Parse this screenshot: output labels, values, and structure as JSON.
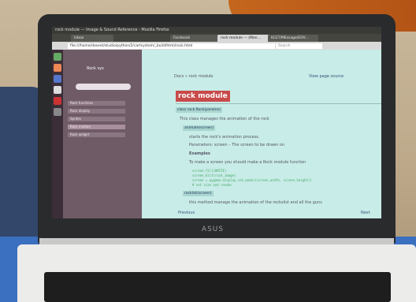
{
  "scene": {
    "table_color": "#3b6fc0",
    "wall_color": "#c9b89c"
  },
  "laptop": {
    "brand": "ASUS"
  },
  "browser": {
    "window_title": "rock module — Image & Sound Reference - Mozilla Firefox",
    "tabs": [
      {
        "label": "Inbox"
      },
      {
        "label": "Facebook"
      },
      {
        "label": "rock module — (Mon…"
      },
      {
        "label": "KCET/MEssage/EOV…"
      }
    ],
    "url": "file:///home/daseet/studio/python/2/cartsystem/_build/html/rock.html",
    "search_placeholder": "Search"
  },
  "sidebar": {
    "title": "Rock sys",
    "items": [
      "Rock functions",
      "Rock display",
      "Sprites",
      "Rock module",
      "Rock widget"
    ]
  },
  "doc": {
    "breadcrumb": "Docs » rock module",
    "view_source": "View page source",
    "title": "rock module",
    "class_sig": "class rock.Rock(params)",
    "class_desc": "This class manages the animation of the rock",
    "method1": "animate(screen)",
    "method1_desc": "starts the rock's animation process.",
    "params": "Parameters:  screen – The screen to be drawn on",
    "examples": "Examples",
    "ex_text": "To make a screen you should make a Rock module function",
    "code": [
      "screen.fill(WHITE)",
      "screen.blit(rock_image)",
      "screen = pygame.display.set_mode((screen_width, screen_height))",
      "# set size and render"
    ],
    "method2": "rocklist(screen)",
    "method2_desc": "this method manage the animation of the rockslist and all the guns",
    "prev": "Previous",
    "next": "Next"
  }
}
